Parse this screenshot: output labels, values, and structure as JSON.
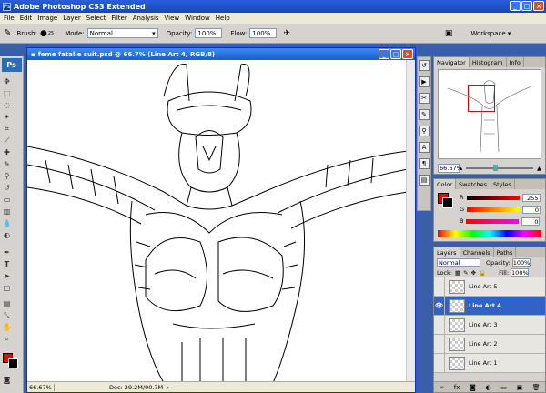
{
  "app": {
    "title": "Adobe Photoshop CS3 Extended",
    "logo": "Ps"
  },
  "menu": [
    "File",
    "Edit",
    "Image",
    "Layer",
    "Select",
    "Filter",
    "Analysis",
    "View",
    "Window",
    "Help"
  ],
  "options": {
    "brush_label": "Brush:",
    "brush_size": "25",
    "mode_label": "Mode:",
    "mode_value": "Normal",
    "opacity_label": "Opacity:",
    "opacity_value": "100%",
    "flow_label": "Flow:",
    "flow_value": "100%",
    "workspace_label": "Workspace"
  },
  "document": {
    "title": "feme fatalle suit.psd @ 66.7% (Line Art 4, RGB/8)",
    "zoom": "66.67%",
    "doc_info": "Doc: 29.2M/90.7M"
  },
  "navigator": {
    "tabs": [
      "Navigator",
      "Histogram",
      "Info"
    ],
    "zoom": "66.67%"
  },
  "color_panel": {
    "tabs": [
      "Color",
      "Swatches",
      "Styles"
    ],
    "r_label": "R",
    "g_label": "G",
    "b_label": "B",
    "r": "255",
    "g": "0",
    "b": "0"
  },
  "layers_panel": {
    "tabs": [
      "Layers",
      "Channels",
      "Paths"
    ],
    "blend_mode": "Normal",
    "opacity_label": "Opacity:",
    "opacity": "100%",
    "lock_label": "Lock:",
    "fill_label": "Fill:",
    "fill": "100%",
    "layers": [
      {
        "name": "Line Art 5",
        "visible": false,
        "active": false
      },
      {
        "name": "Line Art 4",
        "visible": true,
        "active": true
      },
      {
        "name": "Line Art 3",
        "visible": false,
        "active": false
      },
      {
        "name": "Line Art 2",
        "visible": false,
        "active": false
      },
      {
        "name": "Line Art 1",
        "visible": false,
        "active": false
      }
    ]
  },
  "colors": {
    "foreground": "#ee0000",
    "background": "#000000",
    "titlebar": "#1d5ad0",
    "active_layer": "#2f63c7"
  }
}
